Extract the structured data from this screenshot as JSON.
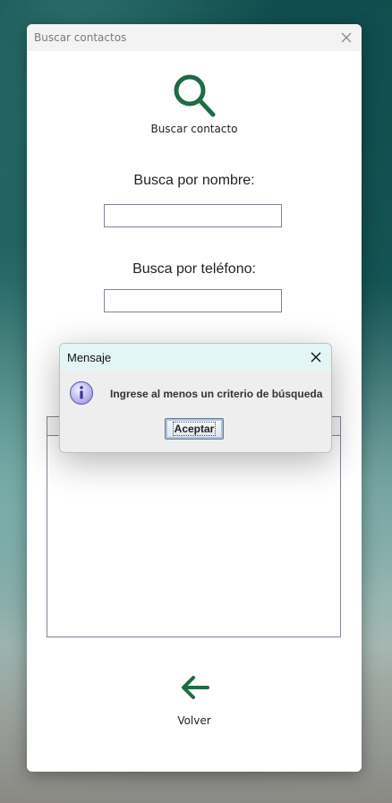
{
  "window": {
    "title": "Buscar contactos"
  },
  "header": {
    "label": "Buscar contacto",
    "icon": "search-icon"
  },
  "form": {
    "name_label": "Busca por nombre:",
    "name_value": "",
    "phone_label": "Busca por teléfono:",
    "phone_value": ""
  },
  "footer": {
    "back_label": "Volver",
    "icon": "arrow-left-icon"
  },
  "dialog": {
    "title": "Mensaje",
    "message": "Ingrese al menos un criterio de búsqueda",
    "ok_label": "Aceptar",
    "icon": "info-icon"
  },
  "colors": {
    "accent": "#1f6b46",
    "dialog_title_bg": "#e3f5f5"
  }
}
